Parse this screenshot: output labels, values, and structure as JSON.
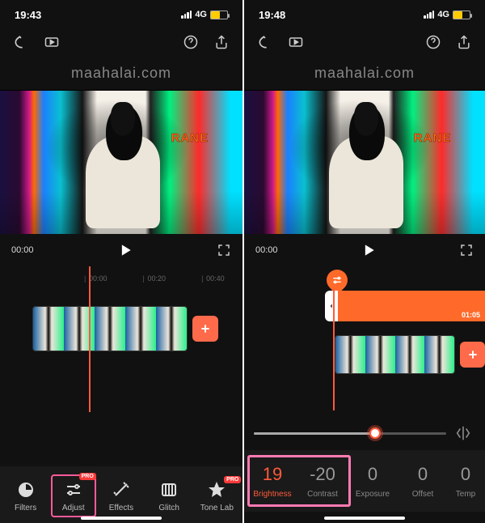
{
  "left": {
    "status": {
      "time": "19:43",
      "network": "4G"
    },
    "watermark": "maahalai.com",
    "player": {
      "current": "00:00"
    },
    "ruler": [
      "00:00",
      "00:20",
      "00:40"
    ],
    "tools": {
      "filters": "Filters",
      "adjust": "Adjust",
      "effects": "Effects",
      "glitch": "Glitch",
      "tonelab": "Tone Lab",
      "pro_badge": "PRO"
    }
  },
  "right": {
    "status": {
      "time": "19:48",
      "network": "4G"
    },
    "watermark": "maahalai.com",
    "player": {
      "current": "00:00"
    },
    "adjust_clip_time": "01:05",
    "slider_percent": 63,
    "params": [
      {
        "key": "brightness",
        "value": "19",
        "label": "Brightness",
        "active": true
      },
      {
        "key": "contrast",
        "value": "-20",
        "label": "Contrast",
        "active": false
      },
      {
        "key": "exposure",
        "value": "0",
        "label": "Exposure",
        "active": false
      },
      {
        "key": "offset",
        "value": "0",
        "label": "Offset",
        "active": false
      },
      {
        "key": "temp",
        "value": "0",
        "label": "Temp",
        "active": false
      }
    ]
  },
  "crane_text": "RANE"
}
